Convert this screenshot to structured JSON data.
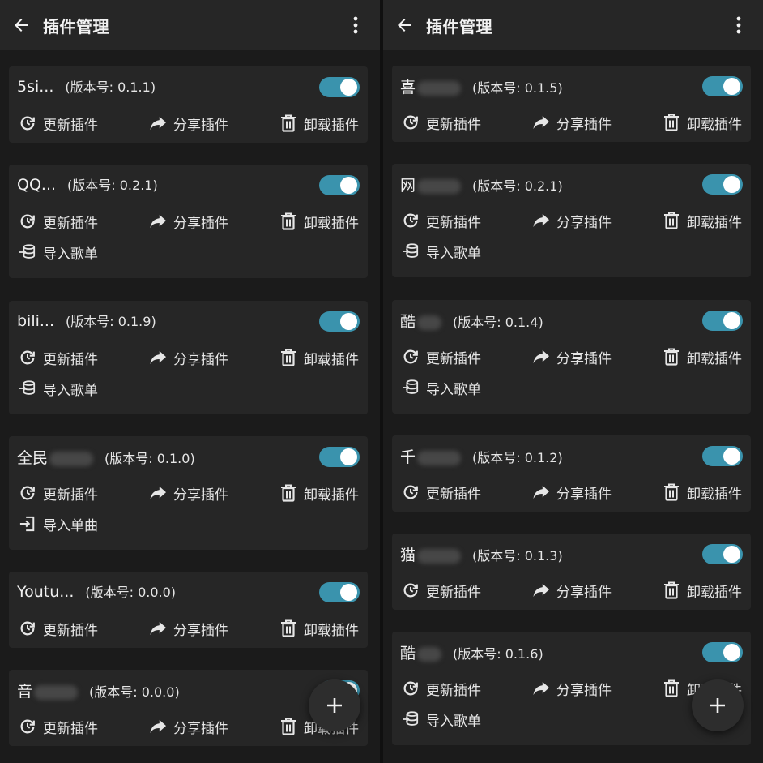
{
  "left": {
    "title": "插件管理",
    "plugins": [
      {
        "name": "5si...",
        "version": "(版本号: 0.1.1)",
        "extra": null
      },
      {
        "name": "QQ...",
        "version": "(版本号: 0.2.1)",
        "extra": "导入歌单"
      },
      {
        "name": "bili...",
        "version": "(版本号: 0.1.9)",
        "extra": "导入歌单"
      },
      {
        "name": "全民",
        "version": "(版本号: 0.1.0)",
        "extra": "导入单曲"
      },
      {
        "name": "Youtu...",
        "version": "(版本号: 0.0.0)",
        "extra": null
      },
      {
        "name": "音",
        "version": "(版本号: 0.0.0)",
        "extra": null
      }
    ]
  },
  "right": {
    "title": "插件管理",
    "plugins": [
      {
        "name": "喜",
        "version": "(版本号: 0.1.5)",
        "extra": null
      },
      {
        "name": "网",
        "version": "(版本号: 0.2.1)",
        "extra": "导入歌单"
      },
      {
        "name": "酷",
        "version": "(版本号: 0.1.4)",
        "extra": "导入歌单"
      },
      {
        "name": "千",
        "version": "(版本号: 0.1.2)",
        "extra": null
      },
      {
        "name": "猫",
        "version": "(版本号: 0.1.3)",
        "extra": null
      },
      {
        "name": "酷",
        "version": "(版本号: 0.1.6)",
        "extra": "导入歌单"
      }
    ]
  },
  "actions": {
    "update": "更新插件",
    "share": "分享插件",
    "uninstall": "卸载插件"
  },
  "fab_symbol": "+",
  "colors": {
    "accent": "#3a93ad",
    "card": "#262626",
    "background": "#1b1b1b"
  },
  "icons": {
    "back": "arrow-left",
    "more": "vertical-dots",
    "update": "refresh",
    "share": "share-arrow",
    "uninstall": "trash",
    "import_playlist": "playlist-import",
    "import_single": "login-arrow"
  }
}
